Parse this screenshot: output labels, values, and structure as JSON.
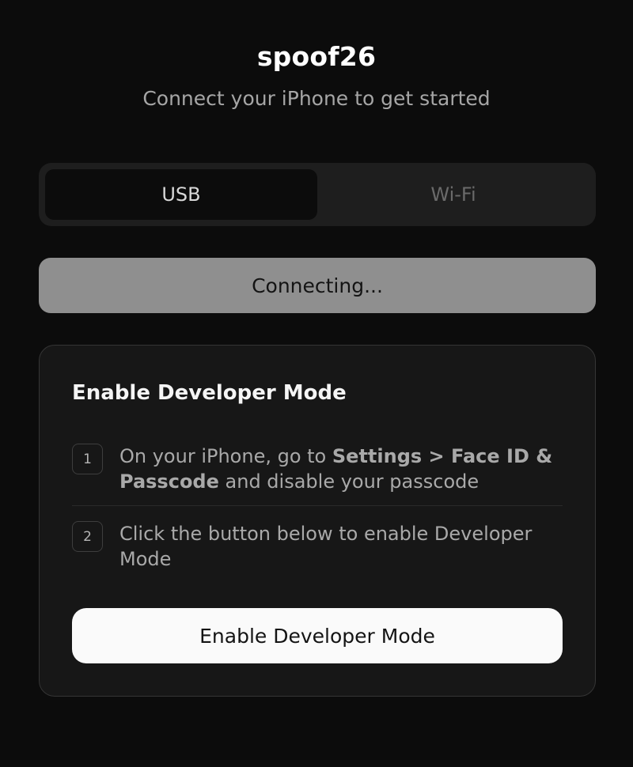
{
  "header": {
    "title": "spoof26",
    "subtitle": "Connect your iPhone to get started"
  },
  "connection_tabs": {
    "selected": "USB",
    "items": [
      {
        "label": "USB"
      },
      {
        "label": "Wi-Fi"
      }
    ]
  },
  "connect_button": {
    "label": "Connecting..."
  },
  "developer_card": {
    "title": "Enable Developer Mode",
    "steps": [
      {
        "number": "1",
        "text_before": "On your iPhone, go to ",
        "text_bold": "Settings > Face ID & Passcode",
        "text_after": " and disable your passcode"
      },
      {
        "number": "2",
        "text": "Click the button below to enable Developer Mode"
      }
    ],
    "button_label": "Enable Developer Mode"
  },
  "colors": {
    "background": "#0c0c0c",
    "segment_bg": "#1e1e1e",
    "connecting_button": "#8f8f8f",
    "card_bg": "#171717",
    "primary_button": "#fafafa"
  }
}
